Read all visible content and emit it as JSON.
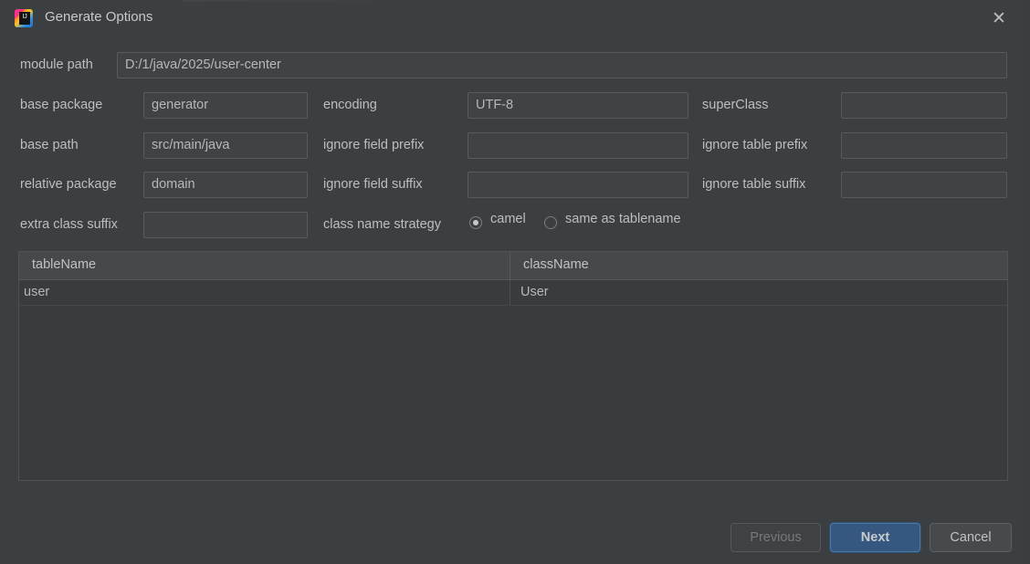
{
  "window": {
    "title": "Generate Options",
    "app_icon": "intellij-idea-icon",
    "icon_text": "IJ",
    "close_label": "✕"
  },
  "form": {
    "module_path": {
      "label": "module path",
      "value": "D:/1/java/2025/user-center",
      "placeholder": ""
    },
    "base_package": {
      "label": "base package",
      "value": "generator",
      "placeholder": ""
    },
    "base_path": {
      "label": "base path",
      "value": "src/main/java",
      "placeholder": ""
    },
    "relative_package": {
      "label": "relative package",
      "value": "domain",
      "placeholder": ""
    },
    "extra_class_suffix": {
      "label": "extra class suffix",
      "value": "",
      "placeholder": ""
    },
    "encoding": {
      "label": "encoding",
      "value": "UTF-8",
      "placeholder": ""
    },
    "ignore_field_prefix": {
      "label": "ignore field prefix",
      "value": "",
      "placeholder": ""
    },
    "ignore_field_suffix": {
      "label": "ignore field suffix",
      "value": "",
      "placeholder": ""
    },
    "super_class": {
      "label": "superClass",
      "value": "",
      "placeholder": ""
    },
    "ignore_table_prefix": {
      "label": "ignore table prefix",
      "value": "",
      "placeholder": ""
    },
    "ignore_table_suffix": {
      "label": "ignore table suffix",
      "value": "",
      "placeholder": ""
    },
    "class_name_strategy": {
      "label": "class name strategy",
      "options": [
        {
          "label": "camel",
          "selected": true
        },
        {
          "label": "same as tablename",
          "selected": false
        }
      ]
    }
  },
  "table": {
    "columns": [
      "tableName",
      "className"
    ],
    "rows": [
      {
        "tableName": "user",
        "className": "User"
      }
    ]
  },
  "buttons": {
    "previous": {
      "label": "Previous",
      "enabled": false
    },
    "next": {
      "label": "Next",
      "primary": true
    },
    "cancel": {
      "label": "Cancel"
    }
  },
  "colors": {
    "dialog_bg": "#3c3f41",
    "field_bg": "#3f4346",
    "field_border": "#585b5d",
    "text": "#bcbec0",
    "primary_button": "#365880",
    "table_header": "#45494b"
  }
}
